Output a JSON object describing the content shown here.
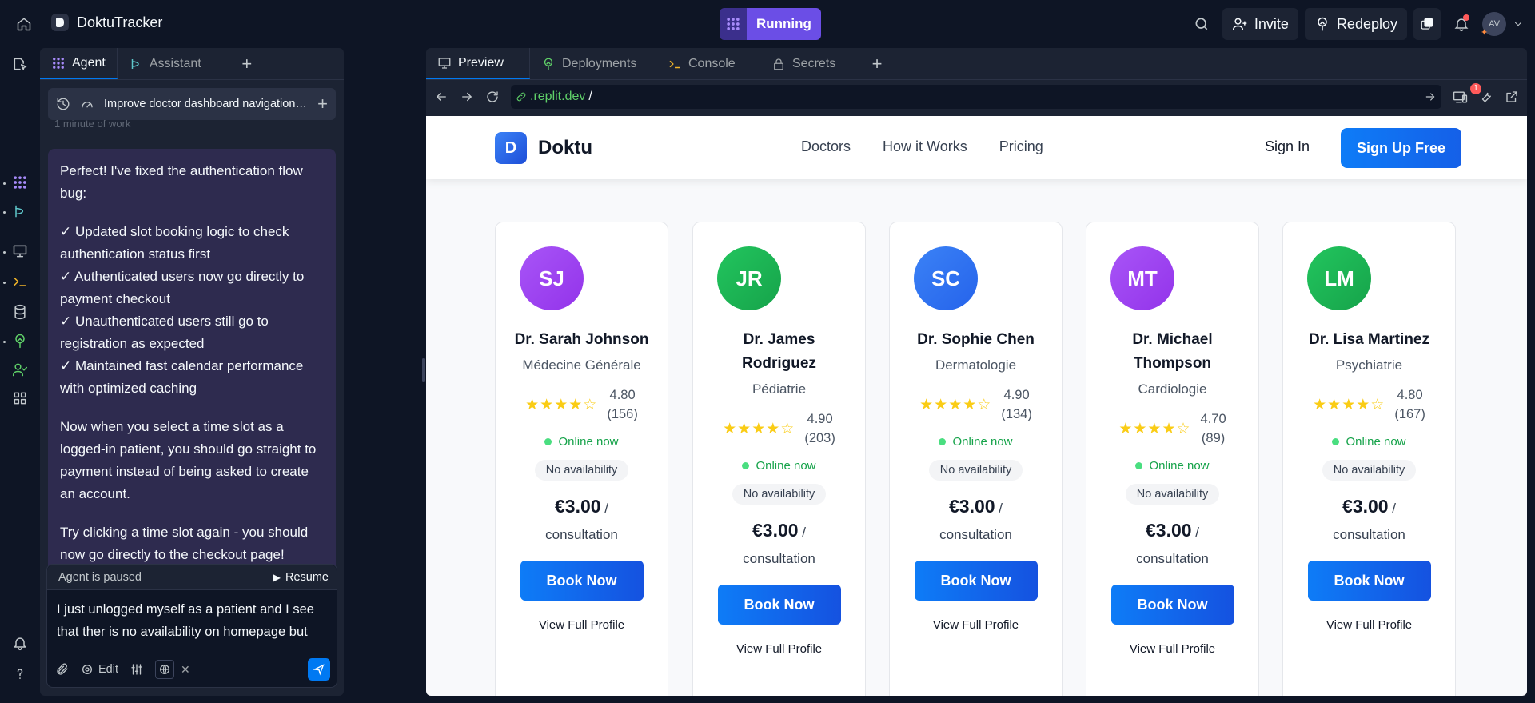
{
  "topbar": {
    "app_name": "DoktuTracker",
    "run_label": "Running",
    "invite_label": "Invite",
    "redeploy_label": "Redeploy",
    "avatar_initials": "AV"
  },
  "agent_pane": {
    "tabs": [
      {
        "label": "Agent"
      },
      {
        "label": "Assistant"
      }
    ],
    "conversation_title": "Improve doctor dashboard navigation wit...",
    "faded_row": "1 minute of work",
    "message": {
      "intro": "Perfect! I've fixed the authentication flow bug:",
      "checks": "✓ Updated slot booking logic to check authentication status first\n✓ Authenticated users now go directly to payment checkout\n✓ Unauthenticated users still go to registration as expected\n✓ Maintained fast calendar performance with optimized caching",
      "p2": "Now when you select a time slot as a logged-in patient, you should go straight to payment instead of being asked to create an account.",
      "p3": "Try clicking a time slot again - you should now go directly to the checkout page!"
    },
    "input": {
      "paused_label": "Agent is paused",
      "resume_label": "Resume",
      "prompt_value": "I just unlogged myself as a patient and I see that ther is no availability on homepage but there is normally",
      "edit_label": "Edit"
    }
  },
  "right_pane": {
    "tabs": [
      {
        "label": "Preview"
      },
      {
        "label": "Deployments"
      },
      {
        "label": "Console"
      },
      {
        "label": "Secrets"
      }
    ],
    "url_domain": ".replit.dev",
    "url_path": "/",
    "badge_count": "1"
  },
  "site": {
    "brand_initial": "D",
    "brand_name": "Doktu",
    "nav": [
      "Doctors",
      "How it Works",
      "Pricing"
    ],
    "sign_in": "Sign In",
    "sign_up": "Sign Up Free",
    "doctors": [
      {
        "initials": "SJ",
        "name": "Dr. Sarah Johnson",
        "specialty": "Médecine Générale",
        "rating": "4.80",
        "reviews": "(156)",
        "stars": 4,
        "online": "Online now",
        "availability": "No availability",
        "price": "€3.00",
        "unit": "/ consultation",
        "book": "Book Now",
        "profile": "View Full Profile",
        "color": "#a855f7"
      },
      {
        "initials": "JR",
        "name": "Dr. James Rodriguez",
        "specialty": "Pédiatrie",
        "rating": "4.90",
        "reviews": "(203)",
        "stars": 4,
        "online": "Online now",
        "availability": "No availability",
        "price": "€3.00",
        "unit": "/ consultation",
        "book": "Book Now",
        "profile": "View Full Profile",
        "color": "#22c55e"
      },
      {
        "initials": "SC",
        "name": "Dr. Sophie Chen",
        "specialty": "Dermatologie",
        "rating": "4.90",
        "reviews": "(134)",
        "stars": 4,
        "online": "Online now",
        "availability": "No availability",
        "price": "€3.00",
        "unit": "/ consultation",
        "book": "Book Now",
        "profile": "View Full Profile",
        "color": "#3b82f6"
      },
      {
        "initials": "MT",
        "name": "Dr. Michael Thompson",
        "specialty": "Cardiologie",
        "rating": "4.70",
        "reviews": "(89)",
        "stars": 4,
        "online": "Online now",
        "availability": "No availability",
        "price": "€3.00",
        "unit": "/ consultation",
        "book": "Book Now",
        "profile": "View Full Profile",
        "color": "#a855f7"
      },
      {
        "initials": "LM",
        "name": "Dr. Lisa Martinez",
        "specialty": "Psychiatrie",
        "rating": "4.80",
        "reviews": "(167)",
        "stars": 4,
        "online": "Online now",
        "availability": "No availability",
        "price": "€3.00",
        "unit": "/ consultation",
        "book": "Book Now",
        "profile": "View Full Profile",
        "color": "#22c55e"
      }
    ]
  },
  "colors": {
    "accent_blue": "#0079f2",
    "run_purple": "#6b4ee6",
    "online_green": "#16a34a",
    "star_yellow": "#facc15"
  }
}
